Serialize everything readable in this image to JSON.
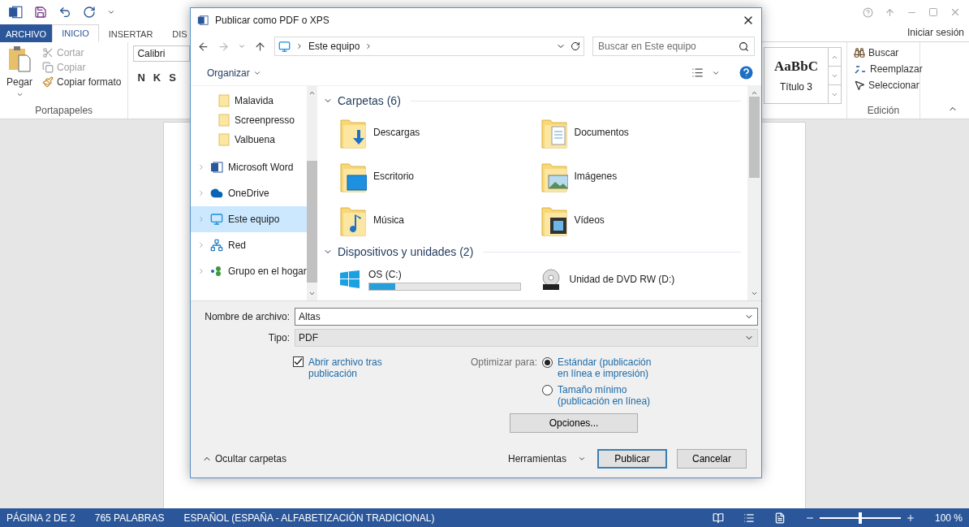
{
  "word": {
    "tabs": [
      {
        "label": "ARCHIVO",
        "kind": "file",
        "selected": false
      },
      {
        "label": "INICIO",
        "kind": "tab",
        "selected": true
      },
      {
        "label": "INSERTAR",
        "kind": "tab",
        "selected": false
      },
      {
        "label": "DIS",
        "kind": "tab",
        "selected": false
      }
    ],
    "user": "Iniciar sesión",
    "clipboard": {
      "label": "Portapapeles",
      "paste": "Pegar",
      "items": [
        {
          "label": "Cortar",
          "kind": "cut",
          "disabled": true
        },
        {
          "label": "Copiar",
          "kind": "copy",
          "disabled": true
        },
        {
          "label": "Copiar formato",
          "kind": "brush",
          "disabled": false
        }
      ]
    },
    "font": {
      "name": "Calibri",
      "buttons": [
        "N",
        "K",
        "S"
      ]
    },
    "styles": {
      "sample": "AaBbC",
      "name": "Título 3"
    },
    "editing": {
      "label": "Edición",
      "items": [
        {
          "label": "Buscar",
          "kind": "find"
        },
        {
          "label": "Reemplazar",
          "kind": "replace"
        },
        {
          "label": "Seleccionar",
          "kind": "select"
        }
      ]
    }
  },
  "dialog": {
    "title": "Publicar como PDF o XPS",
    "breadcrumb": "Este equipo",
    "search": {
      "placeholder": "Buscar en Este equipo"
    },
    "organize": "Organizar",
    "subfolders": [
      "Malavida",
      "Screenpresso",
      "Valbuena"
    ],
    "locations": [
      {
        "label": "Microsoft Word",
        "kind": "word",
        "selected": false
      },
      {
        "label": "OneDrive",
        "kind": "cloud",
        "selected": false
      },
      {
        "label": "Este equipo",
        "kind": "pc",
        "selected": true
      },
      {
        "label": "Red",
        "kind": "network",
        "selected": false
      },
      {
        "label": "Grupo en el hogar",
        "kind": "homegroup",
        "selected": false
      }
    ],
    "sections": [
      {
        "title": "Carpetas (6)",
        "expanded": true,
        "items": [
          {
            "name": "Descargas",
            "kind": "downloads"
          },
          {
            "name": "Documentos",
            "kind": "documents"
          },
          {
            "name": "Escritorio",
            "kind": "desktop"
          },
          {
            "name": "Imágenes",
            "kind": "pictures"
          },
          {
            "name": "Música",
            "kind": "music"
          },
          {
            "name": "Vídeos",
            "kind": "videos"
          }
        ]
      },
      {
        "title": "Dispositivos y unidades (2)",
        "expanded": true,
        "items": [
          {
            "name": "OS (C:)",
            "kind": "drive",
            "level": 0.17
          },
          {
            "name": "Unidad de DVD RW (D:)",
            "kind": "dvd"
          }
        ]
      }
    ],
    "filename": {
      "label": "Nombre de archivo:",
      "value": "Altas"
    },
    "filetype": {
      "label": "Tipo:",
      "value": "PDF"
    },
    "open_after": {
      "label": "Abrir archivo tras publicación",
      "checked": true
    },
    "optimize": {
      "label": "Optimizar para:",
      "options": [
        {
          "label": "Estándar (publicación en línea e impresión)",
          "selected": true
        },
        {
          "label": "Tamaño mínimo (publicación en línea)",
          "selected": false
        }
      ]
    },
    "options_button": "Opciones...",
    "hide_folders": "Ocultar carpetas",
    "tools": "Herramientas",
    "publish": "Publicar",
    "cancel": "Cancelar"
  },
  "status_bar": {
    "page": "PÁGINA 2 DE 2",
    "words": "765 PALABRAS",
    "language": "ESPAÑOL (ESPAÑA - ALFABETIZACIÓN TRADICIONAL)",
    "zoom_slider": {
      "level": 0.5
    },
    "zoom": "100 %"
  }
}
